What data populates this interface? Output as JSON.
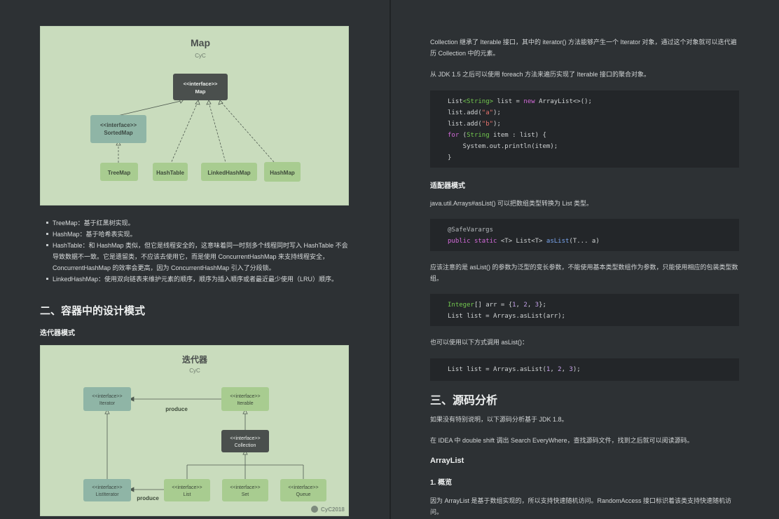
{
  "map_figure": {
    "title": "Map",
    "subtitle": "CyC",
    "nodes": {
      "map": [
        "<<interface>>",
        "Map"
      ],
      "sortedmap": [
        "<<interface>>",
        "SortedMap"
      ],
      "treemap": "TreeMap",
      "hashtable": "HashTable",
      "linkedhashmap": "LinkedHashMap",
      "hashmap": "HashMap"
    },
    "colors": {
      "background": "#c9dcbd",
      "dark_node": "#4a4f4d",
      "teal_node": "#8fb5a6",
      "green_node": "#a8cc90"
    }
  },
  "map_list": [
    "TreeMap：基于红黑树实现。",
    "HashMap：基于哈希表实现。",
    "HashTable：和 HashMap 类似，但它是线程安全的，这意味着同一时刻多个线程同时写入 HashTable 不会导致数据不一致。它是遗留类，不应该去使用它，而是使用 ConcurrentHashMap 来支持线程安全，ConcurrentHashMap 的效率会更高，因为 ConcurrentHashMap 引入了分段锁。",
    "LinkedHashMap：使用双向链表来维护元素的顺序，顺序为插入顺序或者最近最少使用（LRU）顺序。"
  ],
  "section2_heading": "二、容器中的设计模式",
  "iterator_heading": "迭代器模式",
  "iterator_figure": {
    "title": "迭代器",
    "subtitle": "CyC",
    "watermark": "CyC2018",
    "produce_label": "produce",
    "nodes": {
      "iterator": [
        "<<interface>>",
        "Iterator"
      ],
      "iterable": [
        "<<interface>>",
        "Iterable"
      ],
      "collection": [
        "<<interface>>",
        "Collection"
      ],
      "listiterator": [
        "<<interface>>",
        "ListIterator"
      ],
      "list": [
        "<<interface>>",
        "List"
      ],
      "set": [
        "<<interface>>",
        "Set"
      ],
      "queue": [
        "<<interface>>",
        "Queue"
      ]
    }
  },
  "para_collection": "Collection 继承了 Iterable 接口，其中的 iterator() 方法能够产生一个 Iterator 对象，通过这个对象就可以迭代遍历 Collection 中的元素。",
  "para_foreach": "从 JDK 1.5 之后可以使用 foreach 方法来遍历实现了 Iterable 接口的聚合对象。",
  "code1": [
    [
      "List",
      "<String>",
      " list = ",
      "new",
      " ArrayList<>();"
    ],
    "list.add(\"a\");",
    "list.add(\"b\");",
    "for (String item : list) {",
    "    System.out.println(item);",
    "}"
  ],
  "adapter_heading": "适配器模式",
  "para_aslist": "java.util.Arrays#asList() 可以把数组类型转换为 List 类型。",
  "code2": [
    "@SafeVarargs",
    "public static <T> List<T> asList(T... a)"
  ],
  "para_note": "应该注意的是 asList() 的参数为泛型的变长参数，不能使用基本类型数组作为参数，只能使用相应的包装类型数组。",
  "code3": [
    "Integer[] arr = {1, 2, 3};",
    "List list = Arrays.asList(arr);"
  ],
  "para_also": "也可以使用以下方式调用 asList()：",
  "code4": [
    "List list = Arrays.asList(1, 2, 3);"
  ],
  "section3_heading": "三、源码分析",
  "para_jdk": "如果没有特别说明，以下源码分析基于 JDK 1.8。",
  "para_idea": "在 IDEA 中 double shift 调出 Search EveryWhere，查找源码文件，找到之后就可以阅读源码。",
  "arraylist_heading": "ArrayList",
  "overview_heading": "1. 概览",
  "para_overview": "因为 ArrayList 是基于数组实现的，所以支持快速随机访问。RandomAccess 接口标识着该类支持快速随机访问。"
}
